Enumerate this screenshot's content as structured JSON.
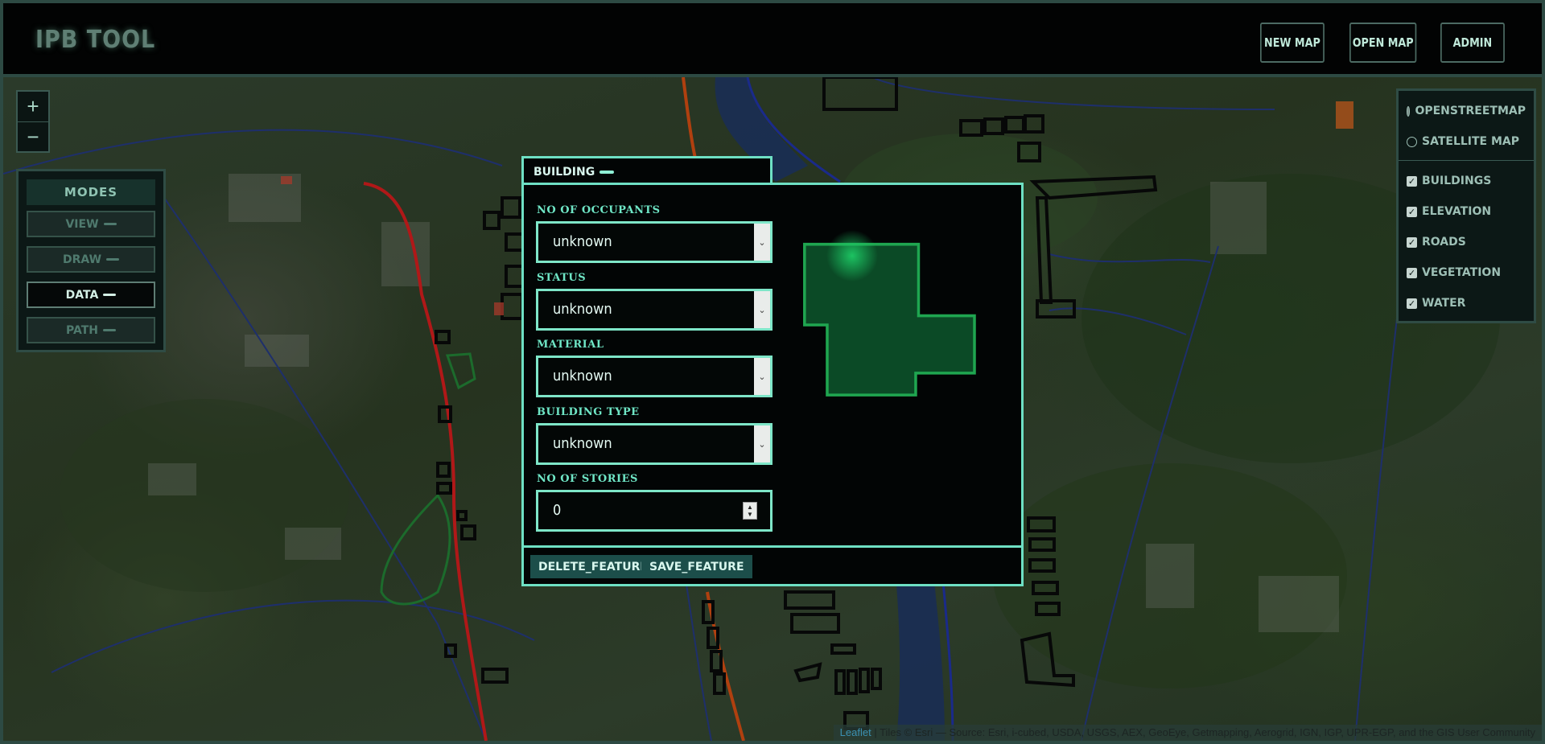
{
  "app": {
    "logo": "IPB TOOL",
    "nav": {
      "new_map": "NEW MAP",
      "open_map": "OPEN MAP",
      "admin": "ADMIN"
    }
  },
  "zoom": {
    "in": "+",
    "out": "−"
  },
  "modes": {
    "title": "MODES",
    "items": [
      {
        "label": "VIEW",
        "active": false
      },
      {
        "label": "DRAW",
        "active": false
      },
      {
        "label": "DATA",
        "active": true
      },
      {
        "label": "PATH",
        "active": false
      }
    ]
  },
  "layers": {
    "basemaps": [
      {
        "label": "OPENSTREETMAP",
        "selected": true
      },
      {
        "label": "SATELLITE MAP",
        "selected": false
      }
    ],
    "overlays": [
      {
        "label": "BUILDINGS",
        "checked": true
      },
      {
        "label": "ELEVATION",
        "checked": true
      },
      {
        "label": "ROADS",
        "checked": true
      },
      {
        "label": "VEGETATION",
        "checked": true
      },
      {
        "label": "WATER",
        "checked": true
      }
    ]
  },
  "dialog": {
    "tab_title": "BUILDING",
    "fields": {
      "occupants": {
        "label": "NO OF OCCUPANTS",
        "value": "unknown"
      },
      "status": {
        "label": "STATUS",
        "value": "unknown"
      },
      "material": {
        "label": "MATERIAL",
        "value": "unknown"
      },
      "building_type": {
        "label": "BUILDING TYPE",
        "value": "unknown"
      },
      "stories": {
        "label": "NO OF STORIES",
        "value": "0"
      }
    },
    "actions": {
      "delete": "DELETE_FEATURE",
      "save": "SAVE_FEATURE"
    }
  },
  "attribution": {
    "link": "Leaflet",
    "text": " | Tiles © Esri — Source: Esri, i-cubed, USDA, USGS, AEX, GeoEye, Getmapping, Aerogrid, IGN, IGP, UPR-EGP, and the GIS User Community"
  },
  "colors": {
    "accent": "#6ee0c4",
    "preview_fill": "#0b4a26",
    "preview_stroke": "#1fa650",
    "road": "#b01818",
    "water": "#1a2a8a"
  }
}
